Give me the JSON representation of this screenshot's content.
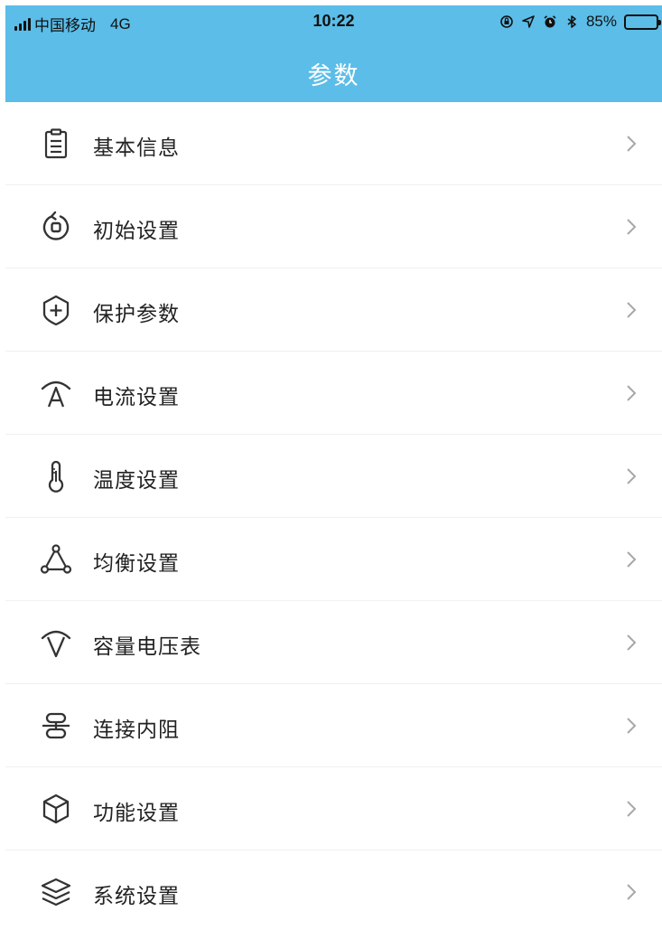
{
  "status_bar": {
    "carrier": "中国移动",
    "network": "4G",
    "time": "10:22",
    "battery": "85%",
    "battery_level": 0.85,
    "icons": [
      "signal-icon",
      "orientation-lock-icon",
      "location-icon",
      "alarm-icon",
      "bluetooth-icon",
      "battery-icon"
    ]
  },
  "header": {
    "title": "参数",
    "background_color": "#5bbde8"
  },
  "menu": {
    "items": [
      {
        "label": "基本信息",
        "icon": "clipboard-icon"
      },
      {
        "label": "初始设置",
        "icon": "reset-icon"
      },
      {
        "label": "保护参数",
        "icon": "shield-plus-icon"
      },
      {
        "label": "电流设置",
        "icon": "current-icon"
      },
      {
        "label": "温度设置",
        "icon": "thermometer-icon"
      },
      {
        "label": "均衡设置",
        "icon": "balance-icon"
      },
      {
        "label": "容量电压表",
        "icon": "voltage-icon"
      },
      {
        "label": "连接内阻",
        "icon": "resistance-icon"
      },
      {
        "label": "功能设置",
        "icon": "cube-icon"
      },
      {
        "label": "系统设置",
        "icon": "layers-icon"
      }
    ],
    "chevron_icon": "chevron-right-icon"
  }
}
